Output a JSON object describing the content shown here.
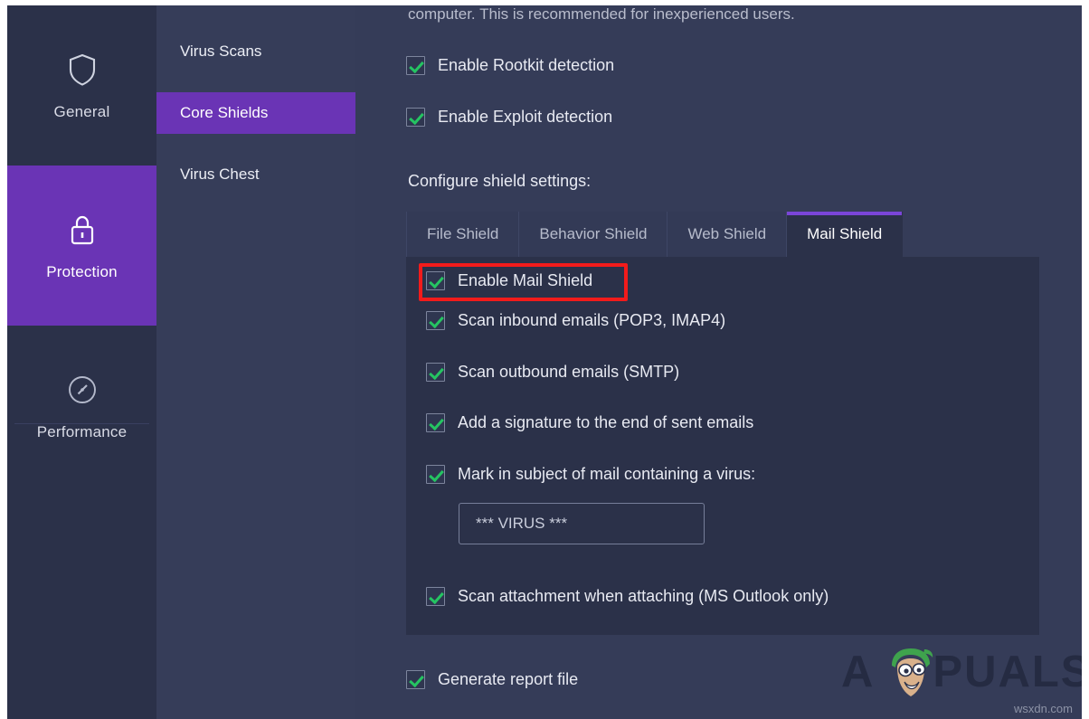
{
  "sidebar": {
    "items": [
      {
        "label": "General",
        "icon": "shield-icon",
        "active": false
      },
      {
        "label": "Protection",
        "icon": "lock-icon",
        "active": true
      },
      {
        "label": "Performance",
        "icon": "speedometer-icon",
        "active": false
      }
    ]
  },
  "nav": {
    "items": [
      {
        "label": "Virus Scans",
        "active": false
      },
      {
        "label": "Core Shields",
        "active": true
      },
      {
        "label": "Virus Chest",
        "active": false
      }
    ]
  },
  "main": {
    "intro_text": "computer. This is recommended for inexperienced users.",
    "top_options": [
      {
        "label": "Enable Rootkit detection",
        "checked": true
      },
      {
        "label": "Enable Exploit detection",
        "checked": true
      }
    ],
    "section_title": "Configure shield settings:",
    "tabs": [
      {
        "label": "File Shield",
        "active": false
      },
      {
        "label": "Behavior Shield",
        "active": false
      },
      {
        "label": "Web Shield",
        "active": false
      },
      {
        "label": "Mail Shield",
        "active": true
      }
    ],
    "mail_shield_options": [
      {
        "label": "Enable Mail Shield",
        "checked": true,
        "highlighted": true
      },
      {
        "label": "Scan inbound emails (POP3, IMAP4)",
        "checked": true
      },
      {
        "label": "Scan outbound emails (SMTP)",
        "checked": true
      },
      {
        "label": "Add a signature to the end of sent emails",
        "checked": true
      },
      {
        "label": "Mark in subject of mail containing a virus:",
        "checked": true
      },
      {
        "label": "Scan attachment when attaching (MS Outlook only)",
        "checked": true
      }
    ],
    "virus_subject_input": {
      "value": "*** VIRUS ***",
      "placeholder": "*** VIRUS ***"
    },
    "generate_report": {
      "label": "Generate report file",
      "checked": true
    }
  },
  "watermark": {
    "brand_prefix": "A",
    "brand_suffix": "PUALS",
    "site": "wsxdn.com"
  },
  "colors": {
    "accent_purple": "#6a34b5",
    "tab_accent": "#7a45d8",
    "panel_dark": "#2b3149",
    "shell": "#353c58",
    "nav_col": "#363d59",
    "rail": "#2b3149",
    "check_green": "#25c462",
    "highlight_red": "#f31b1b"
  }
}
